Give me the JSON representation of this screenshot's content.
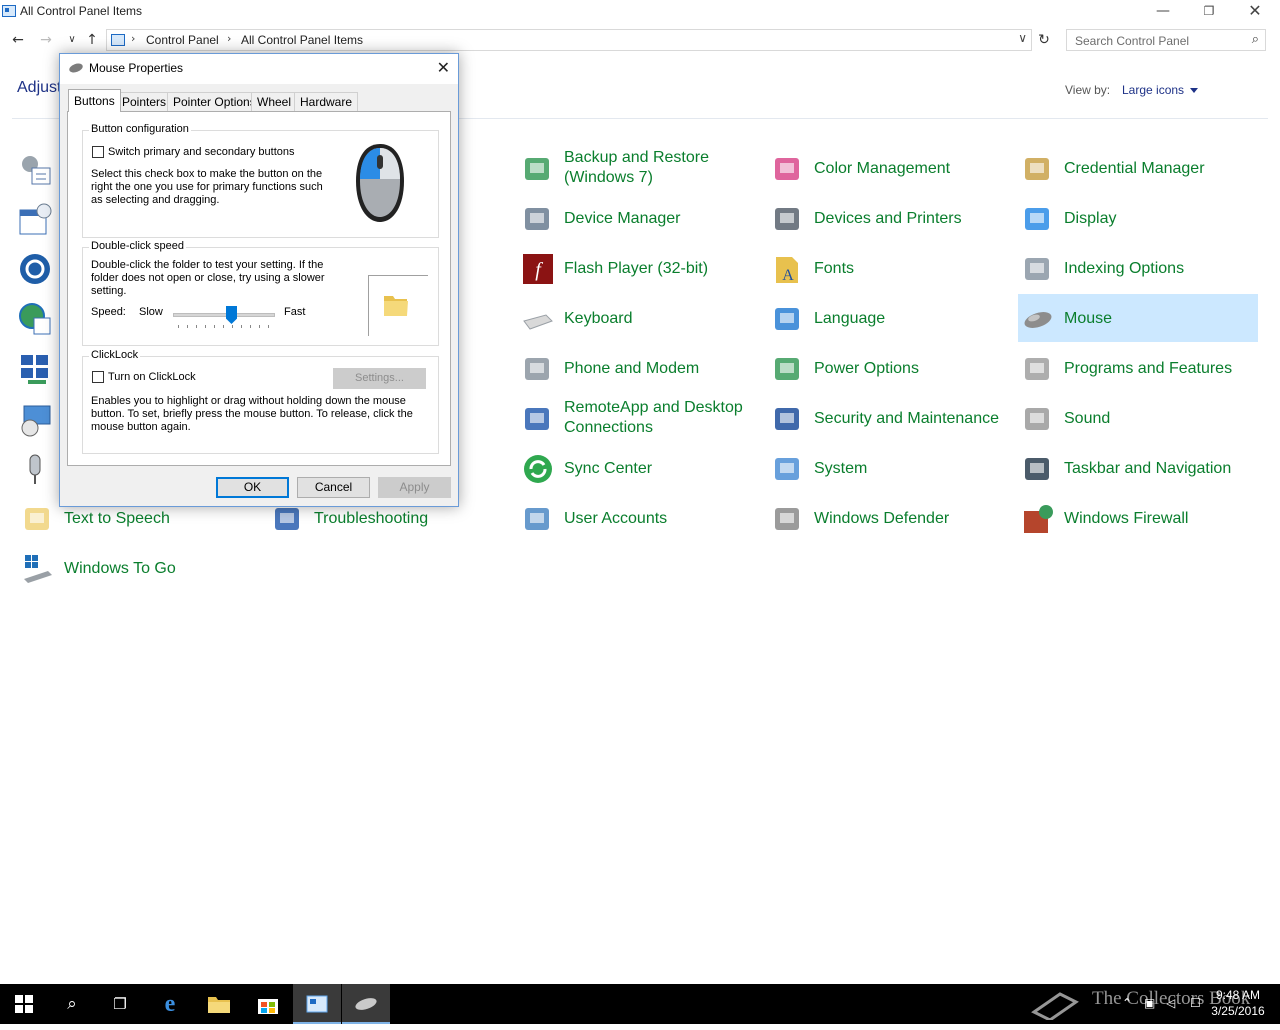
{
  "window": {
    "title": "All Control Panel Items"
  },
  "address": {
    "crumbs": [
      "Control Panel",
      "All Control Panel Items"
    ],
    "search_placeholder": "Search Control Panel"
  },
  "header": {
    "heading": "Adjust",
    "view_by_label": "View by:",
    "view_by_value": "Large icons"
  },
  "items": [
    {
      "label": "Backup and Restore\n(Windows 7)",
      "icon": "backup-restore-icon"
    },
    {
      "label": "Color Management",
      "icon": "color-management-icon"
    },
    {
      "label": "Credential Manager",
      "icon": "credential-manager-icon"
    },
    {
      "label": "Device Manager",
      "icon": "device-manager-icon"
    },
    {
      "label": "Devices and Printers",
      "icon": "devices-printers-icon"
    },
    {
      "label": "Display",
      "icon": "display-icon"
    },
    {
      "label": "Flash Player (32-bit)",
      "icon": "flash-player-icon"
    },
    {
      "label": "Fonts",
      "icon": "fonts-icon"
    },
    {
      "label": "Indexing Options",
      "icon": "indexing-options-icon"
    },
    {
      "label": "Keyboard",
      "icon": "keyboard-icon"
    },
    {
      "label": "Language",
      "icon": "language-icon"
    },
    {
      "label": "Mouse",
      "icon": "mouse-icon",
      "selected": true
    },
    {
      "label": "Phone and Modem",
      "icon": "phone-modem-icon"
    },
    {
      "label": "Power Options",
      "icon": "power-options-icon"
    },
    {
      "label": "Programs and Features",
      "icon": "programs-features-icon"
    },
    {
      "label": "RemoteApp and Desktop\nConnections",
      "icon": "remoteapp-icon"
    },
    {
      "label": "Security and Maintenance",
      "icon": "security-maintenance-icon"
    },
    {
      "label": "Sound",
      "icon": "sound-icon"
    },
    {
      "label": "Sync Center",
      "icon": "sync-center-icon"
    },
    {
      "label": "System",
      "icon": "system-icon"
    },
    {
      "label": "Taskbar and Navigation",
      "icon": "taskbar-navigation-icon"
    },
    {
      "label": "Text to Speech",
      "icon": "text-to-speech-icon"
    },
    {
      "label": "Troubleshooting",
      "icon": "troubleshooting-icon"
    },
    {
      "label": "User Accounts",
      "icon": "user-accounts-icon"
    },
    {
      "label": "Windows Defender",
      "icon": "windows-defender-icon"
    },
    {
      "label": "Windows Firewall",
      "icon": "windows-firewall-icon"
    },
    {
      "label": "Windows To Go",
      "icon": "windows-to-go-icon"
    }
  ],
  "dialog": {
    "title": "Mouse Properties",
    "tabs": [
      "Buttons",
      "Pointers",
      "Pointer Options",
      "Wheel",
      "Hardware"
    ],
    "button_config": {
      "legend": "Button configuration",
      "checkbox_label": "Switch primary and secondary buttons",
      "description": "Select this check box to make the button on the right the one you use for primary functions such as selecting and dragging."
    },
    "double_click": {
      "legend": "Double-click speed",
      "description": "Double-click the folder to test your setting. If the folder does not open or close, try using a slower setting.",
      "speed_label": "Speed:",
      "slow_label": "Slow",
      "fast_label": "Fast",
      "slider_value": 0.6
    },
    "clicklock": {
      "legend": "ClickLock",
      "checkbox_label": "Turn on ClickLock",
      "settings_button": "Settings...",
      "description": "Enables you to highlight or drag without holding down the mouse button. To set, briefly press the mouse button. To release, click the mouse button again."
    },
    "buttons": {
      "ok": "OK",
      "cancel": "Cancel",
      "apply": "Apply"
    }
  },
  "taskbar": {
    "time": "9:48 AM",
    "date": "3/25/2016",
    "watermark": "The Collectors Book"
  },
  "colors": {
    "link_green": "#0a7e2d",
    "accent_blue": "#0078d7",
    "selection": "#cce8ff"
  }
}
